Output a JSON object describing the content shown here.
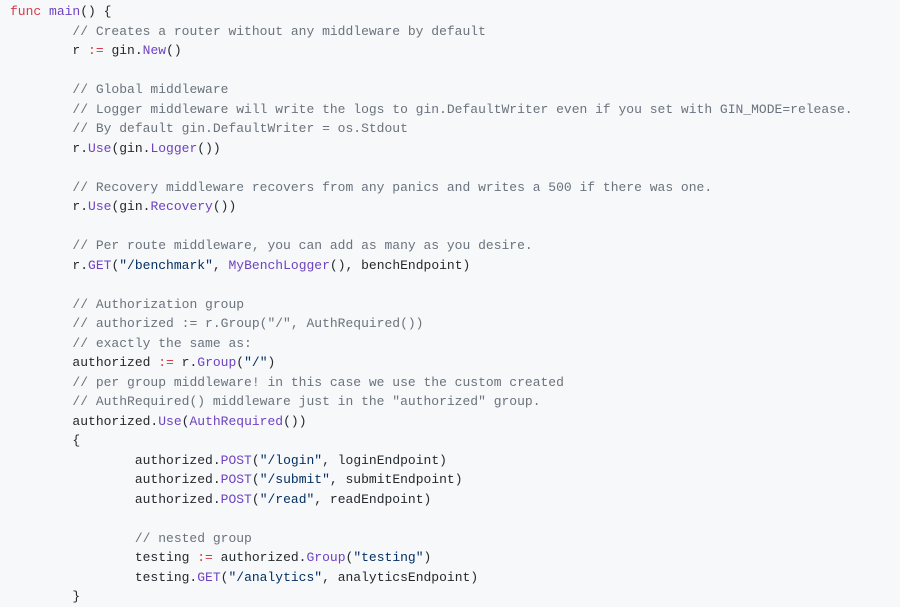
{
  "code": {
    "l1_func": "func",
    "l1_main": "main",
    "l1_rest": "() {",
    "l2": "// Creates a router without any middleware by default",
    "l3_r": "r ",
    "l3_op": ":=",
    "l3_sp": " gin.",
    "l3_new": "New",
    "l3_end": "()",
    "l5": "// Global middleware",
    "l6": "// Logger middleware will write the logs to gin.DefaultWriter even if you set with GIN_MODE=release.",
    "l7": "// By default gin.DefaultWriter = os.Stdout",
    "l8_a": "r.",
    "l8_use": "Use",
    "l8_b": "(gin.",
    "l8_logger": "Logger",
    "l8_c": "())",
    "l10": "// Recovery middleware recovers from any panics and writes a 500 if there was one.",
    "l11_a": "r.",
    "l11_use": "Use",
    "l11_b": "(gin.",
    "l11_rec": "Recovery",
    "l11_c": "())",
    "l13": "// Per route middleware, you can add as many as you desire.",
    "l14_a": "r.",
    "l14_get": "GET",
    "l14_b": "(",
    "l14_s": "\"/benchmark\"",
    "l14_c": ", ",
    "l14_fn": "MyBenchLogger",
    "l14_d": "(), benchEndpoint)",
    "l16": "// Authorization group",
    "l17": "// authorized := r.Group(\"/\", AuthRequired())",
    "l18": "// exactly the same as:",
    "l19_a": "authorized ",
    "l19_op": ":=",
    "l19_b": " r.",
    "l19_grp": "Group",
    "l19_c": "(",
    "l19_s": "\"/\"",
    "l19_d": ")",
    "l20": "// per group middleware! in this case we use the custom created",
    "l21": "// AuthRequired() middleware just in the \"authorized\" group.",
    "l22_a": "authorized.",
    "l22_use": "Use",
    "l22_b": "(",
    "l22_fn": "AuthRequired",
    "l22_c": "())",
    "l23": "{",
    "l24_a": "authorized.",
    "l24_post": "POST",
    "l24_b": "(",
    "l24_s": "\"/login\"",
    "l24_c": ", loginEndpoint)",
    "l25_a": "authorized.",
    "l25_post": "POST",
    "l25_b": "(",
    "l25_s": "\"/submit\"",
    "l25_c": ", submitEndpoint)",
    "l26_a": "authorized.",
    "l26_post": "POST",
    "l26_b": "(",
    "l26_s": "\"/read\"",
    "l26_c": ", readEndpoint)",
    "l28": "// nested group",
    "l29_a": "testing ",
    "l29_op": ":=",
    "l29_b": " authorized.",
    "l29_grp": "Group",
    "l29_c": "(",
    "l29_s": "\"testing\"",
    "l29_d": ")",
    "l30_a": "testing.",
    "l30_get": "GET",
    "l30_b": "(",
    "l30_s": "\"/analytics\"",
    "l30_c": ", analyticsEndpoint)",
    "l31": "}"
  }
}
